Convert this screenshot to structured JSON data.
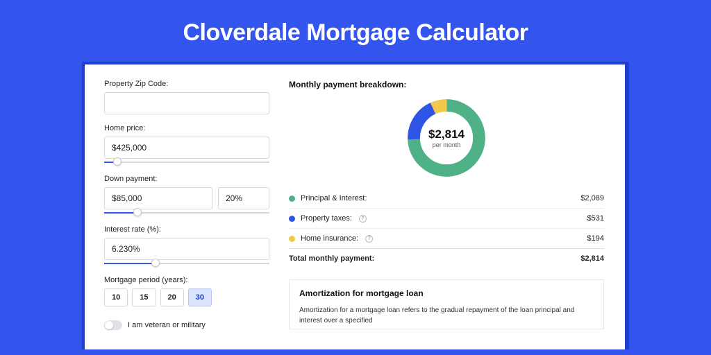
{
  "title": "Cloverdale Mortgage Calculator",
  "form": {
    "zip_label": "Property Zip Code:",
    "zip_value": "",
    "price_label": "Home price:",
    "price_value": "$425,000",
    "price_slider_pct": 8,
    "dp_label": "Down payment:",
    "dp_value": "$85,000",
    "dp_pct_value": "20%",
    "dp_slider_pct": 20,
    "rate_label": "Interest rate (%):",
    "rate_value": "6.230%",
    "rate_slider_pct": 31,
    "period_label": "Mortgage period (years):",
    "period_options": [
      "10",
      "15",
      "20",
      "30"
    ],
    "period_selected": "30",
    "veteran_label": "I am veteran or military"
  },
  "breakdown": {
    "title": "Monthly payment breakdown:",
    "total_label": "per month",
    "total_amount": "$2,814",
    "items": [
      {
        "label": "Principal & Interest:",
        "amount": "$2,089",
        "color": "pi"
      },
      {
        "label": "Property taxes:",
        "amount": "$531",
        "color": "tax",
        "info": true
      },
      {
        "label": "Home insurance:",
        "amount": "$194",
        "color": "ins",
        "info": true
      }
    ],
    "total_row_label": "Total monthly payment:",
    "total_row_amount": "$2,814"
  },
  "amort": {
    "title": "Amortization for mortgage loan",
    "text": "Amortization for a mortgage loan refers to the gradual repayment of the loan principal and interest over a specified"
  },
  "colors": {
    "pi": "#4fb286",
    "tax": "#2f55e6",
    "ins": "#f2c94c"
  },
  "chart_data": {
    "type": "pie",
    "title": "Monthly payment breakdown",
    "series": [
      {
        "name": "Principal & Interest",
        "value": 2089,
        "color": "#4fb286"
      },
      {
        "name": "Property taxes",
        "value": 531,
        "color": "#2f55e6"
      },
      {
        "name": "Home insurance",
        "value": 194,
        "color": "#f2c94c"
      }
    ],
    "center_label": "$2,814",
    "center_sublabel": "per month"
  }
}
